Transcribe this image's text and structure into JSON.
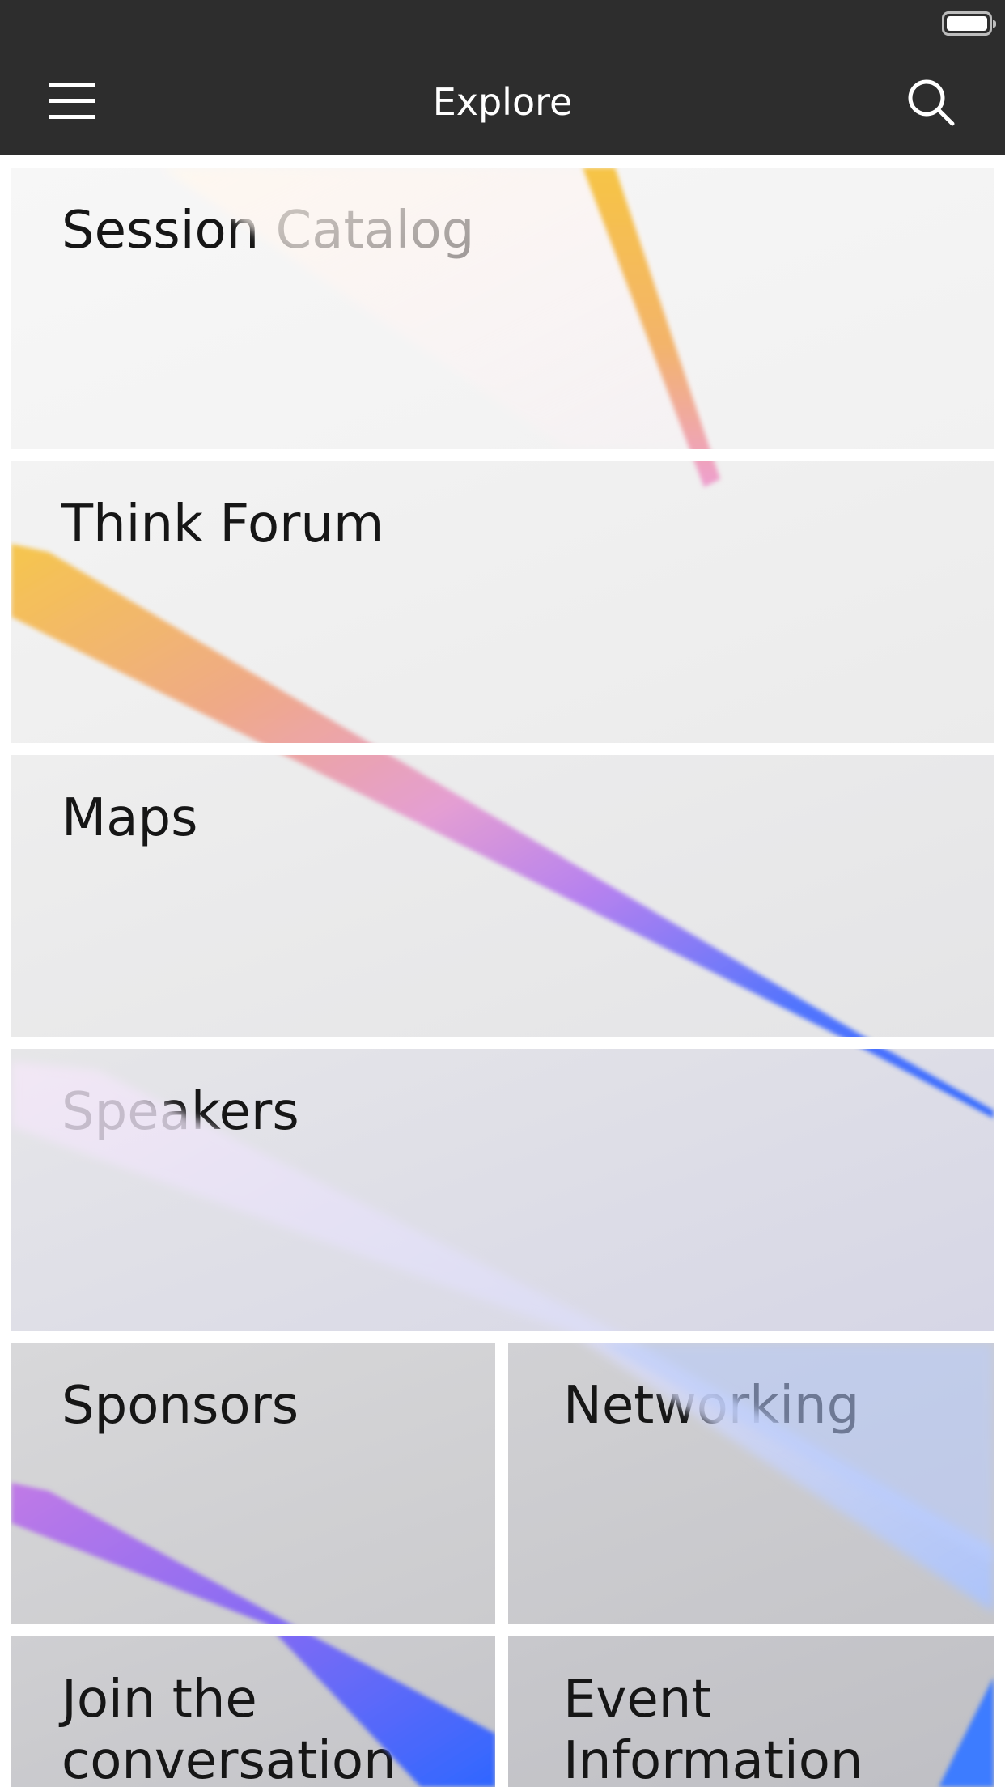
{
  "app_bar": {
    "title": "Explore",
    "menu_icon": "hamburger-menu-icon",
    "search_icon": "search-icon"
  },
  "status_bar": {
    "battery_icon": "battery-icon"
  },
  "tiles": [
    {
      "label": "Session Catalog"
    },
    {
      "label": "Think Forum"
    },
    {
      "label": "Maps"
    },
    {
      "label": "Speakers"
    },
    {
      "label": "Sponsors"
    },
    {
      "label": "Networking"
    },
    {
      "label": "Join the\nconversation"
    },
    {
      "label": "Event\nInformation"
    }
  ],
  "colors": {
    "app_bar_background": "#2d2d2d",
    "app_bar_text": "#ffffff",
    "tile_text": "#161616",
    "ribbon_yellow": "#f6c445",
    "ribbon_pink": "#e7a3c9",
    "ribbon_purple": "#b07cf0",
    "ribbon_blue": "#2f66ff"
  }
}
